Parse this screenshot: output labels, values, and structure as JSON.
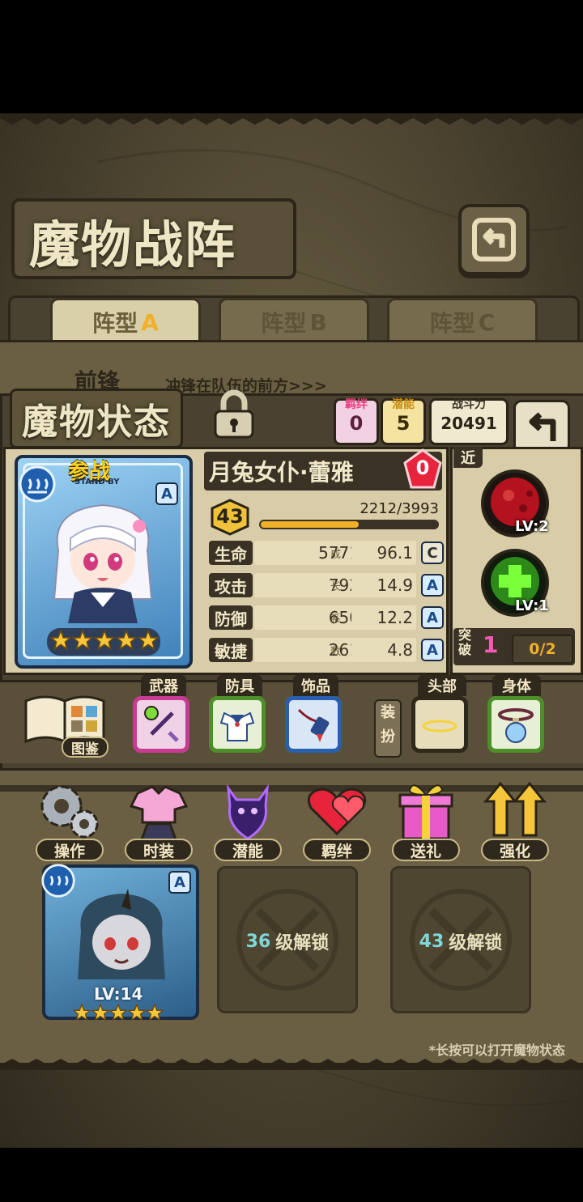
{
  "header": {
    "title": "魔物战阵",
    "back_icon": "back-arrow-icon"
  },
  "formation_tabs": [
    {
      "label": "阵型",
      "letter": "A",
      "active": true
    },
    {
      "label": "阵型",
      "letter": "B",
      "active": false
    },
    {
      "label": "阵型",
      "letter": "C",
      "active": false
    }
  ],
  "row_hint": {
    "title": "前锋",
    "desc": "冲锋在队伍的前方>>>"
  },
  "status": {
    "title": "魔物状态",
    "bond_label": "羁绊",
    "bond_value": "0",
    "potential_label": "潜能",
    "potential_value": "5",
    "power_label": "战斗力",
    "power_value": "20491"
  },
  "character": {
    "name": "月兔女仆·蕾雅",
    "badge_value": "0",
    "level": "43",
    "exp": "2212/3993",
    "exp_progress": 0.554,
    "card_banner": "参战",
    "card_banner_sub": "STAND BY",
    "card_rank": "A",
    "stars": 5,
    "stats": [
      {
        "label": "生命",
        "value": "5771",
        "growth": "96.1",
        "grade": "C"
      },
      {
        "label": "攻击",
        "value": "792",
        "growth": "14.9",
        "grade": "A"
      },
      {
        "label": "防御",
        "value": "650",
        "growth": "12.2",
        "grade": "A"
      },
      {
        "label": "敏捷",
        "value": "261",
        "growth": "4.8",
        "grade": "A"
      }
    ],
    "growth_label_chars": [
      "成",
      "长",
      "系",
      "数"
    ]
  },
  "skills": {
    "range_tag": "近",
    "skill1_level": "LV:2",
    "skill2_level": "LV:1",
    "breakthrough_label_1": "突",
    "breakthrough_label_2": "破",
    "breakthrough_value": "1",
    "breakthrough_progress": "0/2"
  },
  "equipment": {
    "book_label": "图鉴",
    "slots": [
      {
        "label": "武器",
        "icon": "staff-icon"
      },
      {
        "label": "防具",
        "icon": "sailor-uniform-icon"
      },
      {
        "label": "饰品",
        "icon": "charm-pendant-icon"
      }
    ],
    "outfit_label_1": "装",
    "outfit_label_2": "扮",
    "outfit_slots": [
      {
        "label": "头部",
        "icon": "halo-icon"
      },
      {
        "label": "身体",
        "icon": "potion-collar-icon"
      }
    ]
  },
  "actions": [
    {
      "label": "操作",
      "icon": "gears-icon"
    },
    {
      "label": "时装",
      "icon": "outfit-icon"
    },
    {
      "label": "潜能",
      "icon": "demon-silhouette-icon"
    },
    {
      "label": "羁绊",
      "icon": "hearts-icon"
    },
    {
      "label": "送礼",
      "icon": "gift-icon"
    },
    {
      "label": "强化",
      "icon": "upgrade-arrows-icon"
    }
  ],
  "team": {
    "member_level": "LV:14",
    "member_rank": "A",
    "member_stars": 5,
    "locked": [
      {
        "level": "36",
        "text": "级解锁"
      },
      {
        "level": "43",
        "text": "级解锁"
      }
    ],
    "hint": "*长按可以打开魔物状态"
  },
  "colors": {
    "frame": "#3a3224",
    "parchment": "#e7ddbb",
    "accent_gold": "#f0b02a",
    "grade_blue": "#1a4c8a"
  }
}
